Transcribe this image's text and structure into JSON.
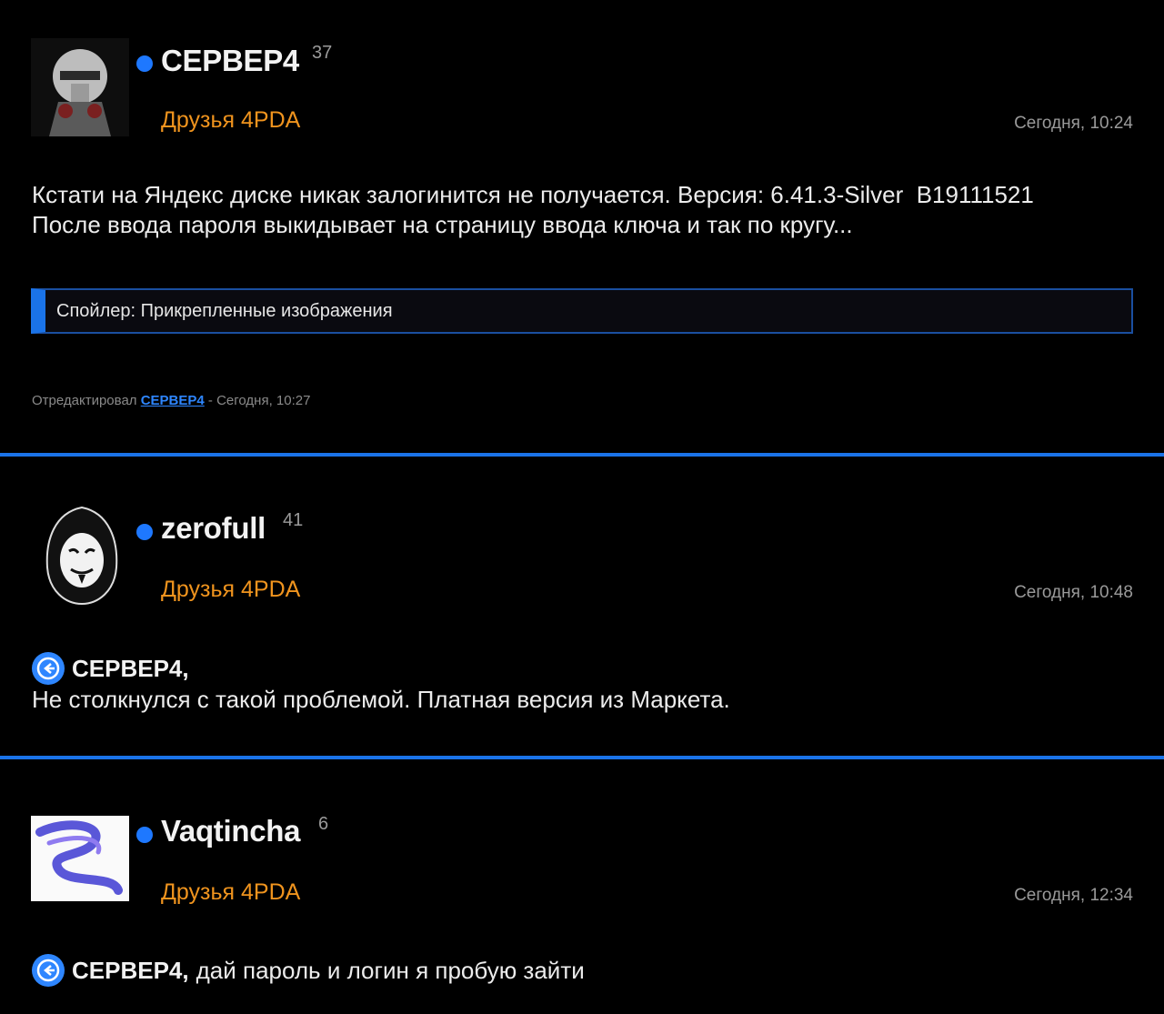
{
  "posts": [
    {
      "author": "СЕРВЕР4",
      "reputation": "37",
      "group": "Друзья 4PDA",
      "date": "Сегодня, 10:24",
      "text": "Кстати на Яндекс диске никак залогинится не получается. Версия: 6.41.3-Silver  B19111521\nПосле ввода пароля выкидывает на страницу ввода ключа и так по кругу...",
      "spoiler": "Спойлер: Прикрепленные изображения",
      "edited_prefix": "Отредактировал",
      "edited_by": "СЕРВЕР4",
      "edited_suffix": "- Сегодня, 10:27",
      "avatar_icon": "robot-helmet-avatar"
    },
    {
      "author": "zerofull",
      "reputation": "41",
      "group": "Друзья 4PDA",
      "date": "Сегодня, 10:48",
      "reply_to": "СЕРВЕР4,",
      "text": "Не столкнулся с такой проблемой. Платная версия из Маркета.",
      "avatar_icon": "anonymous-mask-avatar"
    },
    {
      "author": "Vaqtincha",
      "reputation": "6",
      "group": "Друзья 4PDA",
      "date": "Сегодня, 12:34",
      "reply_to": "СЕРВЕР4,",
      "text": "дай пароль и логин я пробую зайти",
      "avatar_icon": "purple-swirl-avatar"
    }
  ],
  "colors": {
    "background": "#000000",
    "accent": "#1a73e8",
    "group": "#f0941e",
    "online": "#1e78ff"
  }
}
